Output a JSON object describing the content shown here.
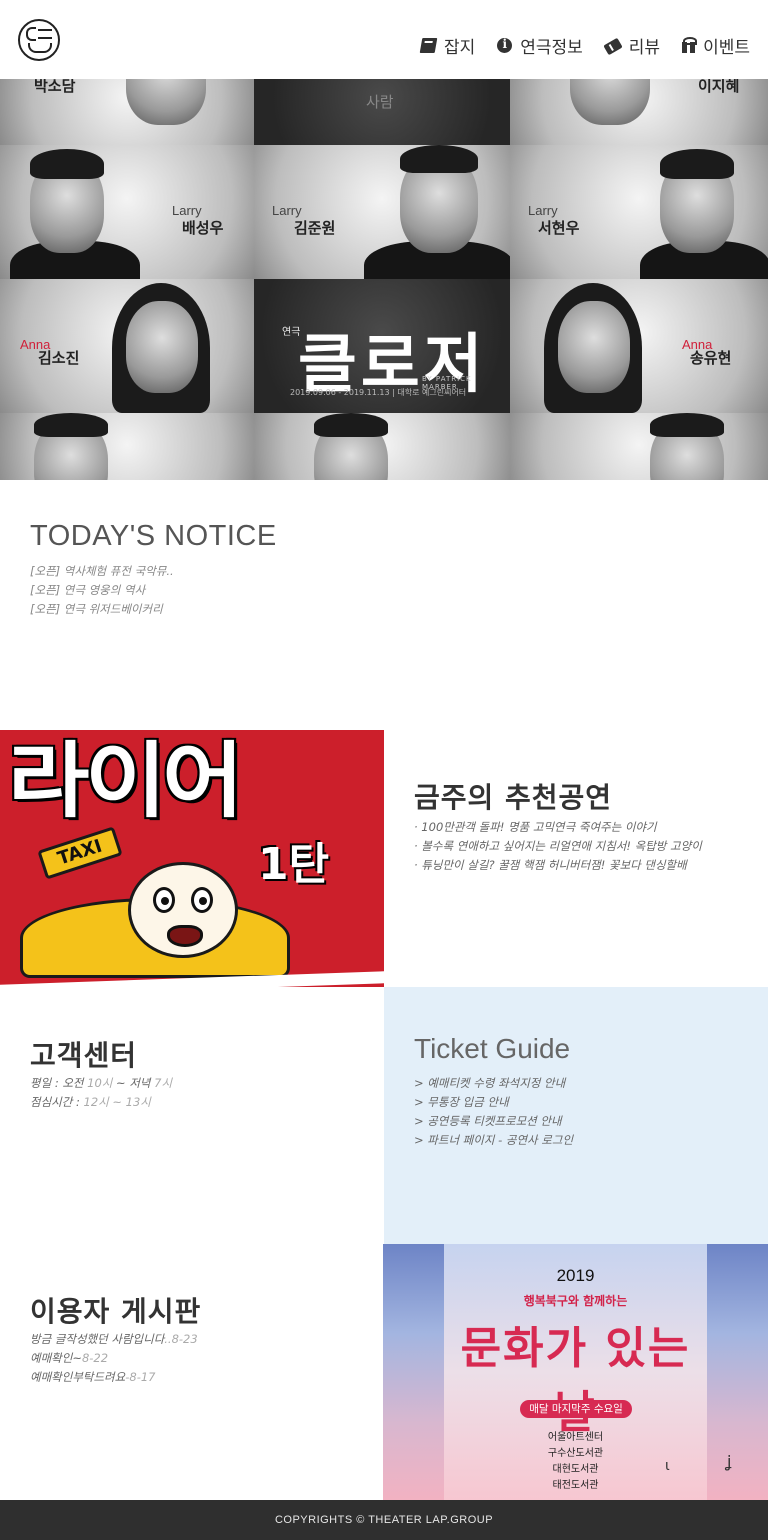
{
  "header": {
    "nav": [
      {
        "label": "잡지",
        "icon": "book-icon"
      },
      {
        "label": "연극정보",
        "icon": "info-icon"
      },
      {
        "label": "리뷰",
        "icon": "ticket-icon"
      },
      {
        "label": "이벤트",
        "icon": "gift-icon"
      }
    ]
  },
  "hero": {
    "kind": "연극",
    "title": "클로저",
    "by": "BY PATRICK MARBER",
    "dates": "2019.09.06 - 2019.11.13 | 대학로 예그린씨어터",
    "cast": [
      {
        "role": "",
        "name": "박소담"
      },
      {
        "role": "",
        "name": "사람"
      },
      {
        "role": "",
        "name": "이지혜"
      },
      {
        "role": "Larry",
        "name": "배성우"
      },
      {
        "role": "Larry",
        "name": "김준원"
      },
      {
        "role": "Larry",
        "name": "서현우"
      },
      {
        "role": "Anna",
        "name": "김소진"
      },
      {
        "role": "Anna",
        "name": "송유현"
      }
    ]
  },
  "notice": {
    "title": "TODAY'S NOTICE",
    "items": [
      "[오픈] 역사체험 퓨전 국악뮤..",
      "[오픈] 연극 영웅의 역사",
      "[오픈] 연극 위저드베이커리"
    ]
  },
  "recommend": {
    "image_title": "라이어",
    "image_num": "1탄",
    "image_sign": "TAXI",
    "title": "금주의 추천공연",
    "items": [
      "· 100만관객 돌파! 명품 고믹연극 죽여주는 이야기",
      "· 볼수록 연애하고 싶어지는 리얼연애 지침서! 옥탑방 고양이",
      "· 튜닝만이 살길? 꿀잼 핵잼 허니버터잼! 꽃보다 댄싱할배"
    ]
  },
  "customer": {
    "title": "고객센터",
    "hours_label": "평일 : 오전",
    "hours_start": "10시",
    "hours_mid": "~ 저녁",
    "hours_end": "7시",
    "lunch_label": "점심시간 :",
    "lunch_range": "12시 ~ 13시"
  },
  "ticket_guide": {
    "title": "Ticket Guide",
    "items": [
      "> 예매티켓 수령 좌석지정 안내",
      "> 무통장 입금 안내",
      "> 공연등록 티켓프로모션 안내",
      "> 파트너 페이지 - 공연사 로그인"
    ]
  },
  "board": {
    "title": "이용자 게시판",
    "posts": [
      {
        "text": "방금 글작성했던 사람입니다",
        "date": "..8-23"
      },
      {
        "text": "예매확인~",
        "date": "8-22"
      },
      {
        "text": "예매확인부탁드려요",
        "date": "-8-17"
      }
    ]
  },
  "poster": {
    "year": "2019",
    "subtitle": "행복북구와 함께하는",
    "main": "문화가 있는 날",
    "badge": "매달 마지막주 수요일",
    "places": [
      "어울아트센터",
      "구수산도서관",
      "대현도서관",
      "태전도서관"
    ]
  },
  "footer": {
    "copyright": "COPYRIGHTS © THEATER LAP.GROUP"
  }
}
